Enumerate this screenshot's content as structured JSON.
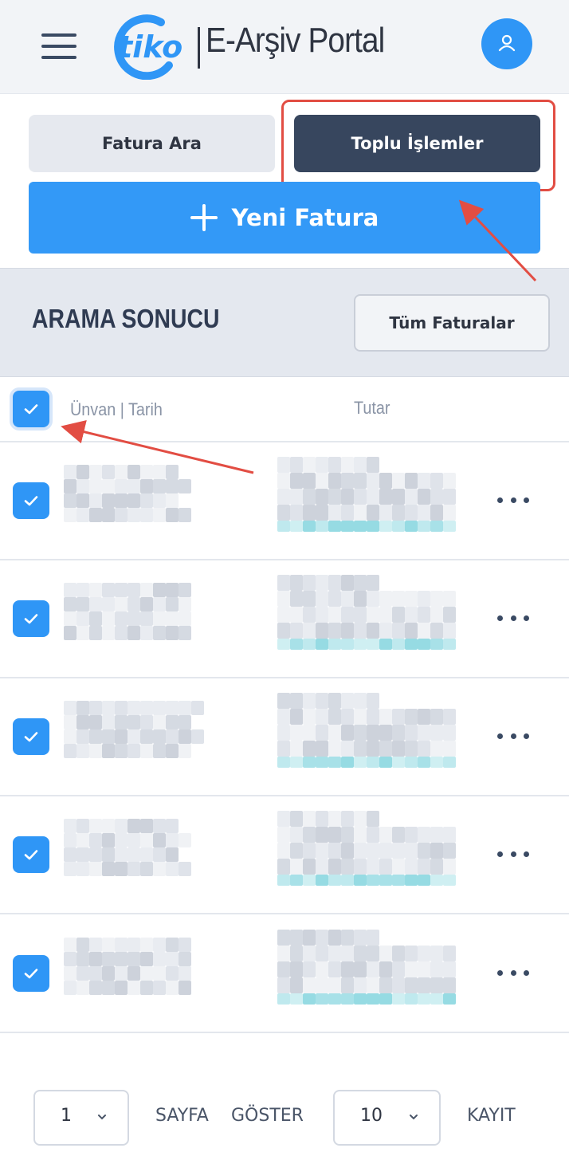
{
  "header": {
    "brand": "tiko",
    "portal_title": "E-Arşiv Portal",
    "brand_color": "#2f96f6",
    "menu_icon": "hamburger-menu-icon",
    "user_icon": "user-icon"
  },
  "actions": {
    "search_tab_label": "Fatura Ara",
    "bulk_tab_label": "Toplu İşlemler",
    "new_invoice_label": "Yeni Fatura",
    "new_invoice_color": "#3399f7",
    "bulk_tab_color": "#37465e"
  },
  "results": {
    "title": "ARAMA SONUCU",
    "all_invoices_label": "Tüm Faturalar"
  },
  "table": {
    "columns": [
      "Ünvan | Tarih",
      "Tutar"
    ],
    "header_checked": true,
    "rows": [
      {
        "checked": true,
        "content": "pixelated"
      },
      {
        "checked": true,
        "content": "pixelated"
      },
      {
        "checked": true,
        "content": "pixelated"
      },
      {
        "checked": true,
        "content": "pixelated"
      },
      {
        "checked": true,
        "content": "pixelated"
      }
    ]
  },
  "pagination": {
    "page_value": "1",
    "page_label": "SAYFA",
    "show_label": "GÖSTER",
    "per_page_value": "10",
    "records_label": "KAYIT"
  },
  "annotation": {
    "highlight_color": "#e24d43"
  }
}
